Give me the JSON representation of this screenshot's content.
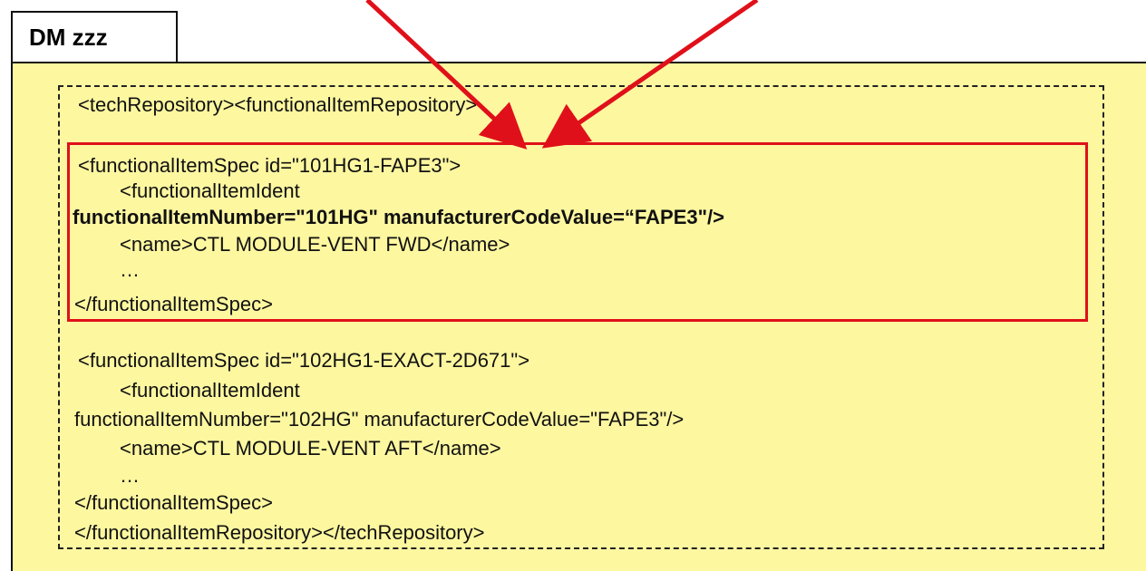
{
  "tab": {
    "title": "DM zzz"
  },
  "lines": {
    "l1": "<techRepository><functionalItemRepository>",
    "l2": "<functionalItemSpec id=\"101HG1-FAPE3\">",
    "l3": "<functionalItemIdent",
    "l4": "functionalItemNumber=\"101HG\"  manufacturerCodeValue=“FAPE3\"/>",
    "l5": "<name>CTL MODULE-VENT FWD</name>",
    "l6": "…",
    "l7": "</functionalItemSpec>",
    "l8": "<functionalItemSpec id=\"102HG1-EXACT-2D671\">",
    "l9": "<functionalItemIdent",
    "l10": "functionalItemNumber=\"102HG\" manufacturerCodeValue=\"FAPE3\"/>",
    "l11": "<name>CTL MODULE-VENT AFT</name>",
    "l12": "…",
    "l13": "</functionalItemSpec>",
    "l14": "</functionalItemRepository></techRepository>"
  },
  "colors": {
    "panel": "#fdf7a0",
    "highlight": "#e0101a",
    "arrow": "#e0101a"
  }
}
